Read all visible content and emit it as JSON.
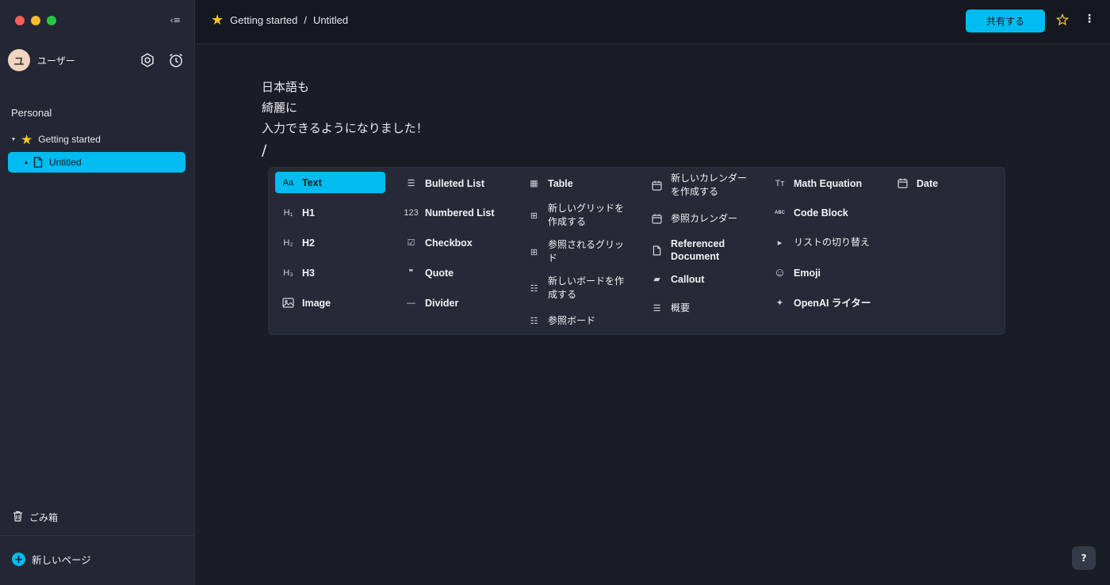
{
  "window": {
    "traffic_lights": [
      "close",
      "minimize",
      "zoom"
    ]
  },
  "sidebar": {
    "collapse_glyph": "‹≡",
    "user": {
      "avatar_initial": "ユ",
      "name": "ユーザー"
    },
    "section_label": "Personal",
    "tree": [
      {
        "label": "Getting started",
        "icon": "star-emoji",
        "expanded": true
      },
      {
        "label": "Untitled",
        "icon": "document-icon",
        "selected": true
      }
    ],
    "trash_label": "ごみ箱",
    "new_page_label": "新しいページ",
    "new_page_plus": "+"
  },
  "topbar": {
    "breadcrumb": {
      "parent": "Getting started",
      "separator": "/",
      "current": "Untitled"
    },
    "share_label": "共有する",
    "more_glyph": "⋮"
  },
  "editor": {
    "lines": [
      "日本語も",
      "綺麗に",
      "入力できるようになりました！"
    ],
    "slash": "/"
  },
  "slash_menu": {
    "col1": [
      {
        "label": "Text",
        "icon": "text-icon",
        "glyph": "Aa",
        "active": true
      },
      {
        "label": "H1",
        "icon": "heading1-icon",
        "glyph": "H₁"
      },
      {
        "label": "H2",
        "icon": "heading2-icon",
        "glyph": "H₂"
      },
      {
        "label": "H3",
        "icon": "heading3-icon",
        "glyph": "H₃"
      },
      {
        "label": "Image",
        "icon": "image-icon",
        "glyph": ""
      }
    ],
    "col2": [
      {
        "label": "Bulleted List",
        "icon": "bulleted-list-icon",
        "glyph": "☰"
      },
      {
        "label": "Numbered List",
        "icon": "numbered-list-icon",
        "glyph": "123"
      },
      {
        "label": "Checkbox",
        "icon": "checkbox-icon",
        "glyph": "☑"
      },
      {
        "label": "Quote",
        "icon": "quote-icon",
        "glyph": "❞"
      },
      {
        "label": "Divider",
        "icon": "divider-icon",
        "glyph": "—"
      }
    ],
    "col3": [
      {
        "label": "Table",
        "icon": "table-icon",
        "glyph": "▦"
      },
      {
        "label": "新しいグリッドを作成する",
        "icon": "grid-icon",
        "glyph": "⊞"
      },
      {
        "label": "参照されるグリッド",
        "icon": "grid-icon",
        "glyph": "⊞"
      },
      {
        "label": "新しいボードを作成する",
        "icon": "board-icon",
        "glyph": "☷"
      },
      {
        "label": "参照ボード",
        "icon": "board-icon",
        "glyph": "☷"
      }
    ],
    "col4": [
      {
        "label": "新しいカレンダーを作成する",
        "icon": "calendar-icon",
        "glyph": "📅"
      },
      {
        "label": "参照カレンダー",
        "icon": "calendar-icon",
        "glyph": "📅"
      },
      {
        "label": "Referenced Document",
        "icon": "document-icon",
        "glyph": ""
      },
      {
        "label": "Callout",
        "icon": "callout-icon",
        "glyph": "▰"
      },
      {
        "label": "概要",
        "icon": "outline-icon",
        "glyph": "☰"
      }
    ],
    "col5": [
      {
        "label": "Math Equation",
        "icon": "math-icon",
        "glyph": "Tт"
      },
      {
        "label": "Code Block",
        "icon": "code-block-icon",
        "glyph": "ABC"
      },
      {
        "label": "リストの切り替え",
        "icon": "toggle-icon",
        "glyph": "▸"
      },
      {
        "label": "Emoji",
        "icon": "emoji-icon",
        "glyph": "☺"
      },
      {
        "label": "OpenAI ライター",
        "icon": "ai-icon",
        "glyph": "✦"
      }
    ],
    "col6": [
      {
        "label": "Date",
        "icon": "calendar-icon",
        "glyph": "📅"
      }
    ]
  },
  "help_glyph": "?",
  "colors": {
    "accent": "#00bcf0",
    "sidebar_bg": "#232734",
    "main_bg": "#1a1d26",
    "menu_bg": "#252a36"
  }
}
